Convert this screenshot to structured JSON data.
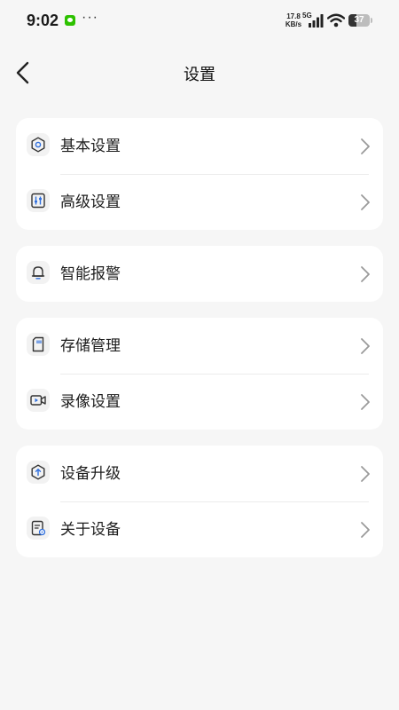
{
  "status_bar": {
    "time": "9:02",
    "more": "···",
    "net_speed_value": "17.8",
    "net_speed_unit": "KB/s",
    "network_type": "5G",
    "battery_level": "37",
    "icons": [
      "wechat-icon",
      "signal-icon",
      "wifi-icon",
      "battery-icon"
    ]
  },
  "header": {
    "title": "设置",
    "back_icon": "chevron-left-icon"
  },
  "groups": [
    {
      "items": [
        {
          "label": "基本设置",
          "icon": "gear-icon"
        },
        {
          "label": "高级设置",
          "icon": "sliders-icon"
        }
      ]
    },
    {
      "items": [
        {
          "label": "智能报警",
          "icon": "bell-icon"
        }
      ]
    },
    {
      "items": [
        {
          "label": "存储管理",
          "icon": "sd-card-icon"
        },
        {
          "label": "录像设置",
          "icon": "video-camera-icon"
        }
      ]
    },
    {
      "items": [
        {
          "label": "设备升级",
          "icon": "upgrade-icon"
        },
        {
          "label": "关于设备",
          "icon": "device-info-icon"
        }
      ]
    }
  ],
  "colors": {
    "background": "#f6f6f6",
    "card": "#ffffff",
    "icon_blue": "#2f6fde",
    "chevron": "#9a9a9a"
  }
}
